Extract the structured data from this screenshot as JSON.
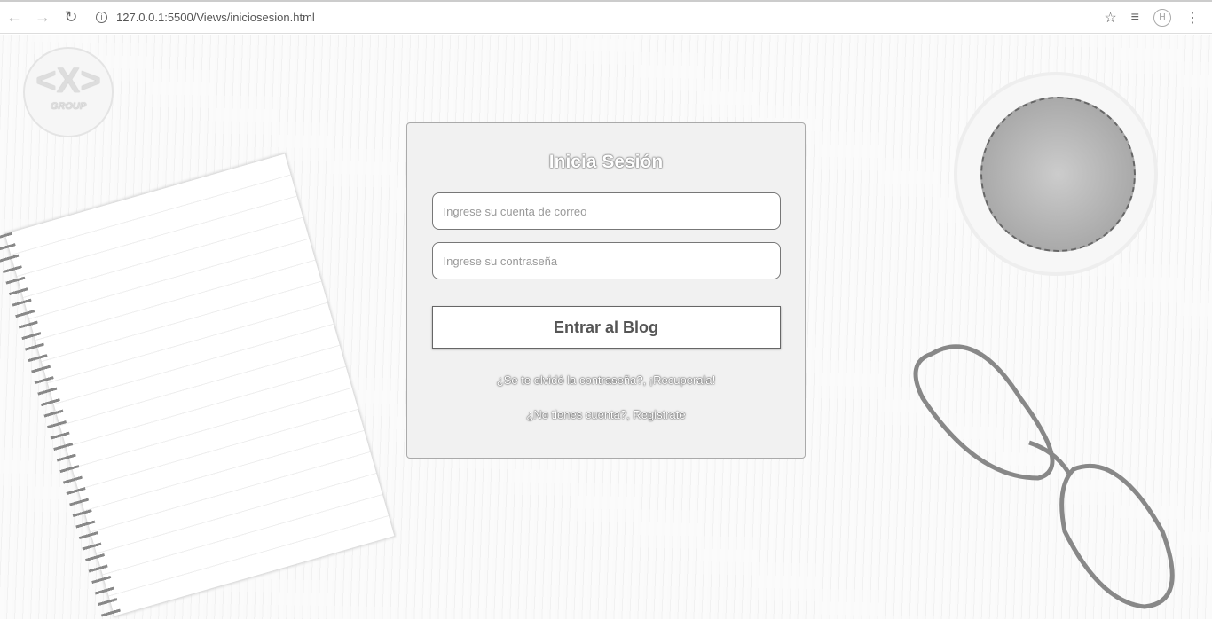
{
  "browser": {
    "url": "127.0.0.1:5500/Views/iniciosesion.html"
  },
  "logo": {
    "text": "<X>",
    "subtext": "GROUP"
  },
  "login": {
    "title": "Inicia Sesión",
    "email_placeholder": "Ingrese su cuenta de correo",
    "password_placeholder": "Ingrese su contraseña",
    "submit_label": "Entrar al Blog",
    "forgot_link": "¿Se te olvidó la contraseña?, ¡Recuperala!",
    "register_link": "¿No tienes cuenta?, Registrate"
  }
}
